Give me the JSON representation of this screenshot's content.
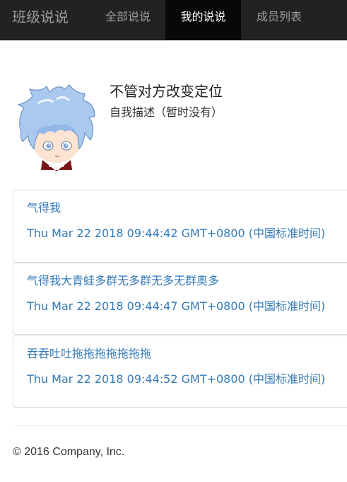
{
  "navbar": {
    "brand": "班级说说",
    "items": [
      {
        "label": "全部说说",
        "active": false
      },
      {
        "label": "我的说说",
        "active": true
      },
      {
        "label": "成员列表",
        "active": false
      }
    ]
  },
  "profile": {
    "name": "不管对方改变定位",
    "bio": "自我描述（暂时没有）",
    "avatar_icon": "anime-avatar-icon"
  },
  "posts": [
    {
      "text": "气得我",
      "time": "Thu Mar 22 2018 09:44:42 GMT+0800 (中国标准时间)"
    },
    {
      "text": "气得我大青蛙多群无多群无多无群奥多",
      "time": "Thu Mar 22 2018 09:44:47 GMT+0800 (中国标准时间)"
    },
    {
      "text": "吞吞吐吐拖拖拖拖拖拖拖",
      "time": "Thu Mar 22 2018 09:44:52 GMT+0800 (中国标准时间)"
    }
  ],
  "footer": {
    "text": "© 2016 Company, Inc."
  },
  "colors": {
    "navbar": "#222222",
    "active_tab": "#080808",
    "link": "#337ab7",
    "border": "#dddddd"
  }
}
